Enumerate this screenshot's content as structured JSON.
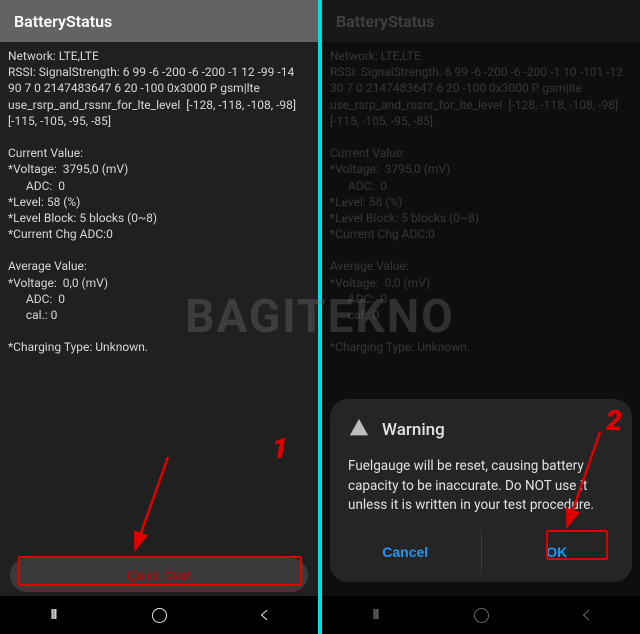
{
  "watermark": "BAGITEKNO",
  "left": {
    "title": "BatteryStatus",
    "body": "Network: LTE,LTE\nRSSI: SignalStrength: 6 99 -6 -200 -6 -200 -1 12 -99 -14 90 7 0 2147483647 6 20 -100 0x3000 P gsm|lte use_rsrp_and_rssnr_for_lte_level  [-128, -118, -108, -98] [-115, -105, -95, -85]\n\nCurrent Value:\n*Voltage:  3795,0 (mV)\n      ADC:  0\n*Level: 58 (%)\n*Level Block: 5 blocks (0~8)\n*Current Chg ADC:0\n\nAverage Value:\n*Voltage:  0,0 (mV)\n      ADC:  0\n      cal.: 0\n\n*Charging Type: Unknown.",
    "quick_start": "Quick Start"
  },
  "right": {
    "title": "BatteryStatus",
    "body": "Network: LTE,LTE\nRSSI: SignalStrength: 6 99 -6 -200 -6 -200 -1 10 -101 -12 30 7 0 2147483647 6 20 -100 0x3000 P gsm|lte use_rsrp_and_rssnr_for_lte_level  [-128, -118, -108, -98] [-115, -105, -95, -85]\n\nCurrent Value:\n*Voltage:  3795,0 (mV)\n      ADC:  0\n*Level: 58 (%)\n*Level Block: 5 blocks (0~8)\n*Current Chg ADC:0\n\nAverage Value:\n*Voltage:  0,0 (mV)\n      ADC:  0\n      cal.: 0\n\n*Charging Type: Unknown."
  },
  "dialog": {
    "title": "Warning",
    "body": "Fuelgauge will be reset, causing battery capacity to be inaccurate.\nDo NOT use it unless it is written in your test procedure.",
    "cancel": "Cancel",
    "ok": "OK"
  },
  "annotations": {
    "step1": "1",
    "step2": "2"
  }
}
